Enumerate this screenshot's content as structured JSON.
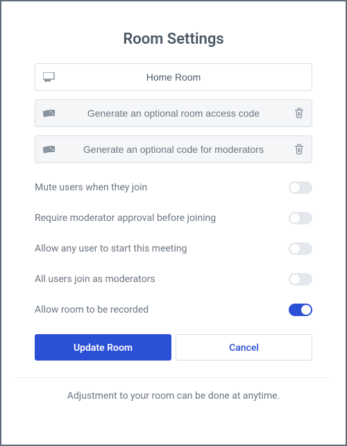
{
  "title": "Room Settings",
  "fields": {
    "name": {
      "value": "Home Room"
    },
    "access_code": {
      "placeholder": "Generate an optional room access code"
    },
    "mod_code": {
      "placeholder": "Generate an optional code for moderators"
    }
  },
  "toggles": {
    "mute": {
      "label": "Mute users when they join",
      "on": false
    },
    "approval": {
      "label": "Require moderator approval before joining",
      "on": false
    },
    "anystart": {
      "label": "Allow any user to start this meeting",
      "on": false
    },
    "allmods": {
      "label": "All users join as moderators",
      "on": false
    },
    "record": {
      "label": "Allow room to be recorded",
      "on": true
    }
  },
  "buttons": {
    "update": "Update Room",
    "cancel": "Cancel"
  },
  "footnote": "Adjustment to your room can be done at anytime."
}
